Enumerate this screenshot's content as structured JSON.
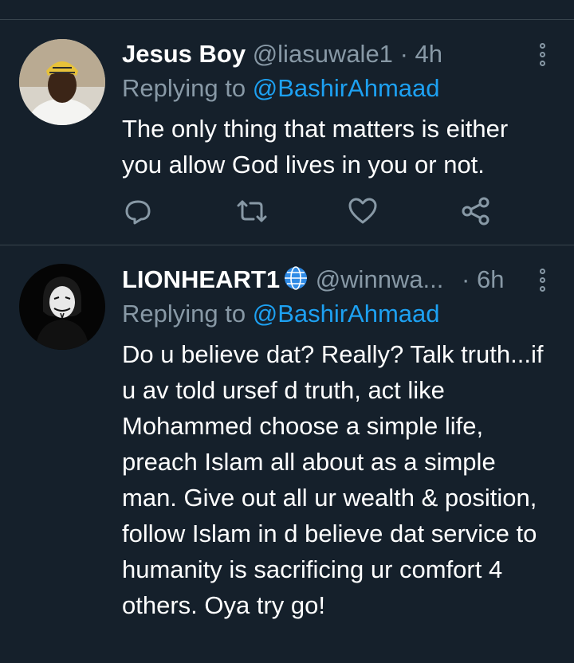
{
  "tweets": [
    {
      "name": "Jesus Boy",
      "handle": "@liasuwale1",
      "separator": "·",
      "time": "4h",
      "replying_prefix": "Replying to",
      "replying_to": "@BashirAhmaad",
      "text": "The only thing that matters is either you allow God lives in you or not."
    },
    {
      "name": "LIONHEART1",
      "handle": "@winnwa...",
      "separator": "·",
      "time": "6h",
      "replying_prefix": "Replying to",
      "replying_to": "@BashirAhmaad",
      "text": "Do u believe dat? Really? Talk truth...if u av told ursef d truth, act like Mohammed choose a simple life, preach Islam all about as a simple man. Give out all ur wealth & position, follow Islam in d believe dat service to humanity is sacrificing ur comfort 4 others. Oya try go!"
    }
  ],
  "icons": {
    "action_bar": [
      "reply-icon",
      "retweet-icon",
      "like-icon",
      "share-icon"
    ],
    "badge": "globe-icon",
    "menu": "more-options-icon"
  },
  "colors": {
    "background": "#15202b",
    "divider": "#38444d",
    "secondary_text": "#8899a6",
    "link": "#1da1f2"
  }
}
